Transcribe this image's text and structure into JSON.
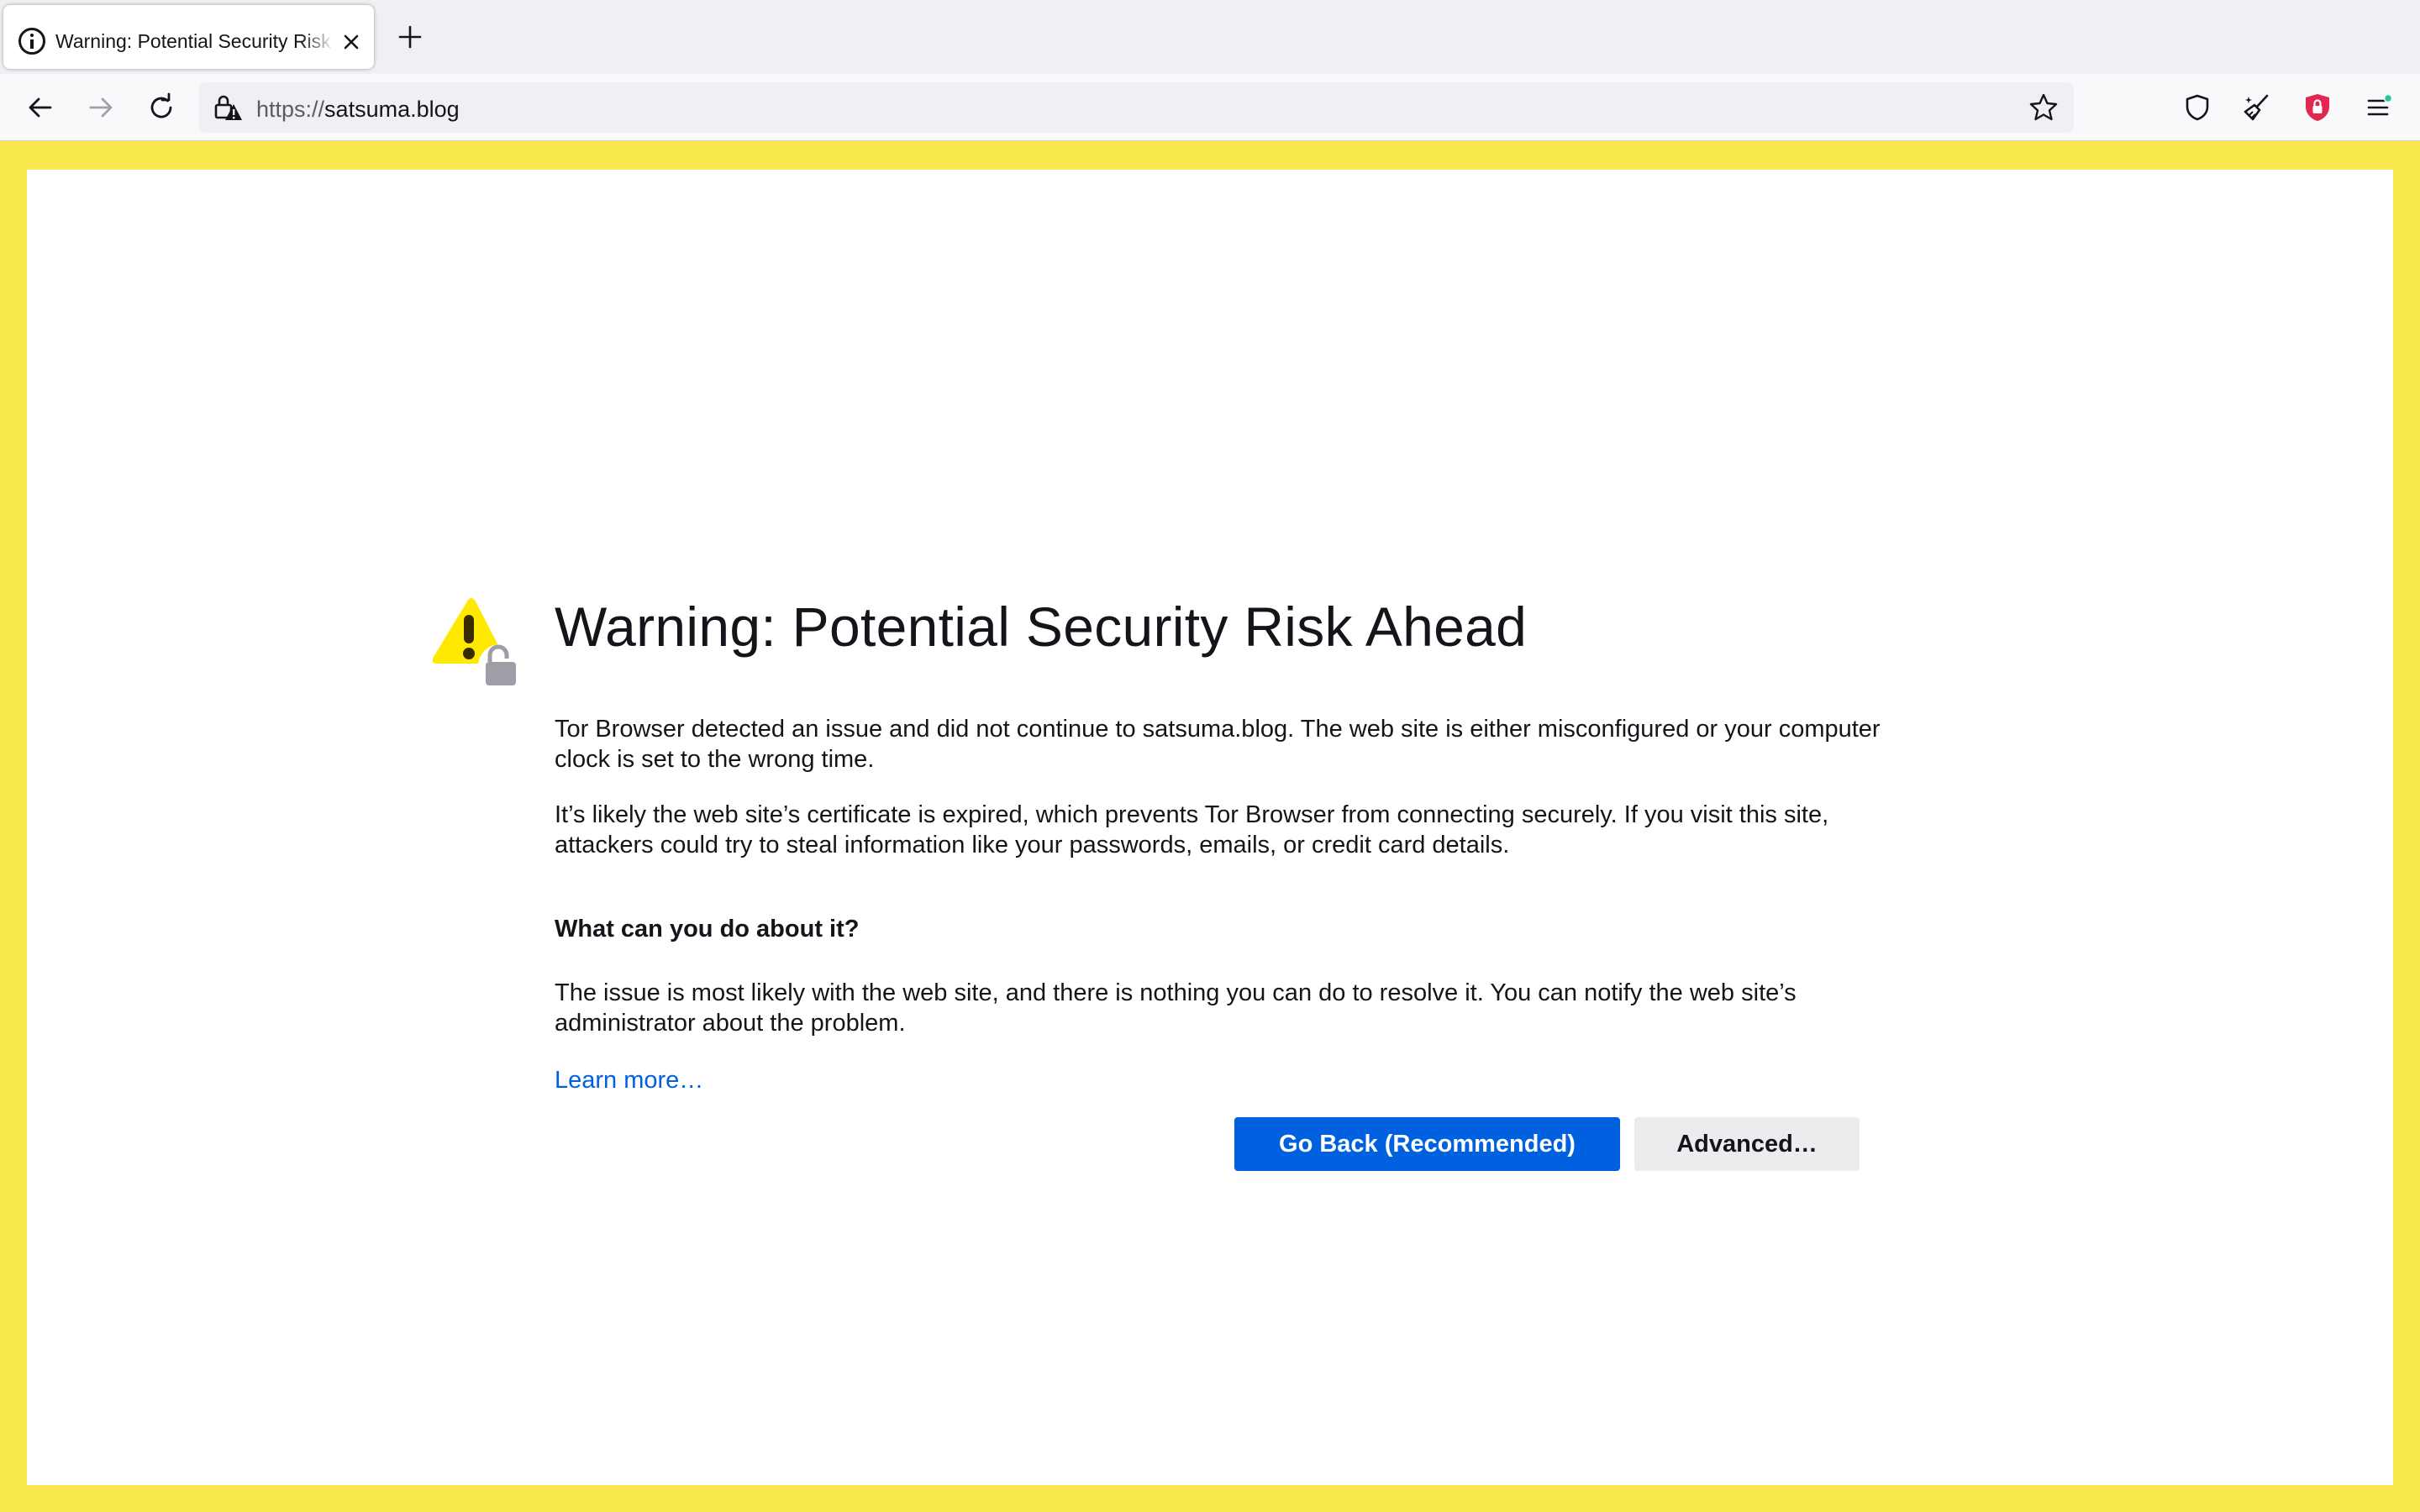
{
  "browser": {
    "tab": {
      "title": "Warning: Potential Security Risk Ahead",
      "icon": "info-icon"
    },
    "url": {
      "protocol": "https://",
      "host": "satsuma.blog"
    },
    "toolbar_icons": [
      "back-arrow-icon",
      "forward-arrow-icon",
      "reload-icon",
      "lock-warning-icon",
      "bookmark-star-icon",
      "shield-icon",
      "new-identity-broom-icon",
      "ublock-shield-icon",
      "menu-icon"
    ]
  },
  "page": {
    "title": "Warning: Potential Security Risk Ahead",
    "para1": "Tor Browser detected an issue and did not continue to satsuma.blog. The web site is either misconfigured or your computer clock is set to the wrong time.",
    "para2": "It’s likely the web site’s certificate is expired, which prevents Tor Browser from connecting securely. If you visit this site, attackers could try to steal information like your passwords, emails, or credit card details.",
    "question": "What can you do about it?",
    "para3": "The issue is most likely with the web site, and there is nothing you can do to resolve it. You can notify the web site’s administrator about the problem.",
    "learn_more": "Learn more…",
    "go_back_label": "Go Back (Recommended)",
    "advanced_label": "Advanced…"
  },
  "colors": {
    "frame": "#f9e94e",
    "primary_button": "#0061e0",
    "link": "#0061e0",
    "warning_yellow": "#ffe900",
    "ublock_red": "#e22850"
  }
}
